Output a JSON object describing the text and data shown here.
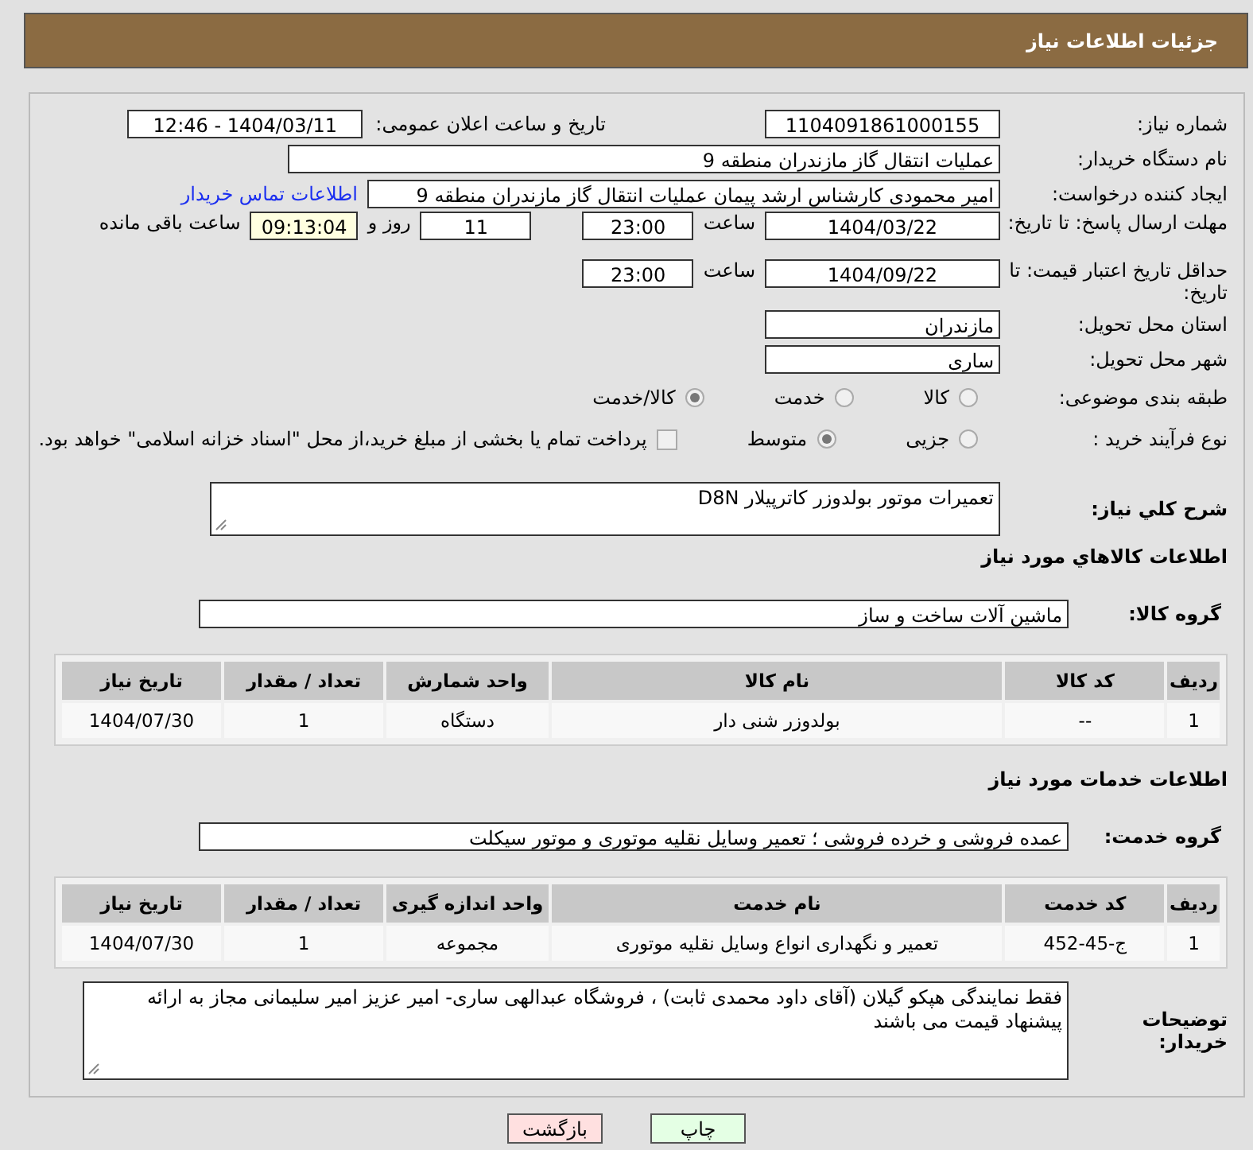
{
  "header": {
    "title": "جزئیات اطلاعات نیاز"
  },
  "need_number": {
    "label": "شماره نیاز:",
    "value": "1104091861000155"
  },
  "announce": {
    "label": "تاریخ و ساعت اعلان عمومی:",
    "value": "1404/03/11 - 12:46"
  },
  "buyer_org": {
    "label": "نام دستگاه خریدار:",
    "value": "عملیات انتقال گاز مازندران منطقه 9"
  },
  "requester": {
    "label": "ایجاد کننده درخواست:",
    "value": "امیر محمودی کارشناس ارشد پیمان عملیات انتقال گاز مازندران منطقه 9",
    "link": "اطلاعات تماس خریدار"
  },
  "reply_deadline": {
    "label": "مهلت ارسال پاسخ: تا تاریخ:",
    "date": "1404/03/22",
    "time_label": "ساعت",
    "time": "23:00",
    "days": "11",
    "days_label": "روز و",
    "remaining": "09:13:04",
    "remaining_label": "ساعت باقی مانده"
  },
  "price_validity": {
    "label": "حداقل تاریخ اعتبار قیمت: تا تاریخ:",
    "date": "1404/09/22",
    "time_label": "ساعت",
    "time": "23:00"
  },
  "province": {
    "label": "استان محل تحویل:",
    "value": "مازندران"
  },
  "city": {
    "label": "شهر محل تحویل:",
    "value": "ساری"
  },
  "category": {
    "label": "طبقه بندی موضوعی:",
    "options": [
      {
        "label": "کالا",
        "selected": false
      },
      {
        "label": "خدمت",
        "selected": false
      },
      {
        "label": "کالا/خدمت",
        "selected": true
      }
    ]
  },
  "process": {
    "label": "نوع فرآیند خرید :",
    "options": [
      {
        "label": "جزیی",
        "selected": false
      },
      {
        "label": "متوسط",
        "selected": true
      }
    ],
    "payment": {
      "checked": false,
      "text": "پرداخت تمام یا بخشی از مبلغ خرید،از محل \"اسناد خزانه اسلامی\" خواهد بود."
    }
  },
  "description": {
    "label": "شرح کلي نياز:",
    "value": "تعمیرات موتور بولدوزر کاترپیلار D8N"
  },
  "goods": {
    "title": "اطلاعات کالاهاي مورد نياز",
    "group_label": "گروه کالا:",
    "group": "ماشین آلات ساخت و ساز",
    "columns": [
      "ردیف",
      "کد کالا",
      "نام کالا",
      "واحد شمارش",
      "تعداد / مقدار",
      "تاریخ نیاز"
    ],
    "rows": [
      [
        "1",
        "--",
        "بولدوزر شنی دار",
        "دستگاه",
        "1",
        "1404/07/30"
      ]
    ]
  },
  "services": {
    "title": "اطلاعات خدمات مورد نياز",
    "group_label": "گروه خدمت:",
    "group": "عمده فروشی و خرده فروشی ؛ تعمیر وسایل نقلیه موتوری و موتور سیکلت",
    "columns": [
      "ردیف",
      "کد خدمت",
      "نام خدمت",
      "واحد اندازه گیری",
      "تعداد / مقدار",
      "تاریخ نیاز"
    ],
    "rows": [
      [
        "1",
        "ج-45-452",
        "تعمیر و نگهداری انواع وسایل نقلیه موتوری",
        "مجموعه",
        "1",
        "1404/07/30"
      ]
    ]
  },
  "buyer_notes": {
    "label": "توضیحات خریدار:",
    "value": "فقط نمایندگی هپکو گیلان (آقای داود محمدی ثابت) ، فروشگاه عبدالهی ساری- امیر عزیز امیر سلیمانی مجاز به ارائه پیشنهاد قیمت می باشند"
  },
  "buttons": [
    {
      "label": "چاپ",
      "kind": "print"
    },
    {
      "label": "بازگشت",
      "kind": "back"
    }
  ]
}
